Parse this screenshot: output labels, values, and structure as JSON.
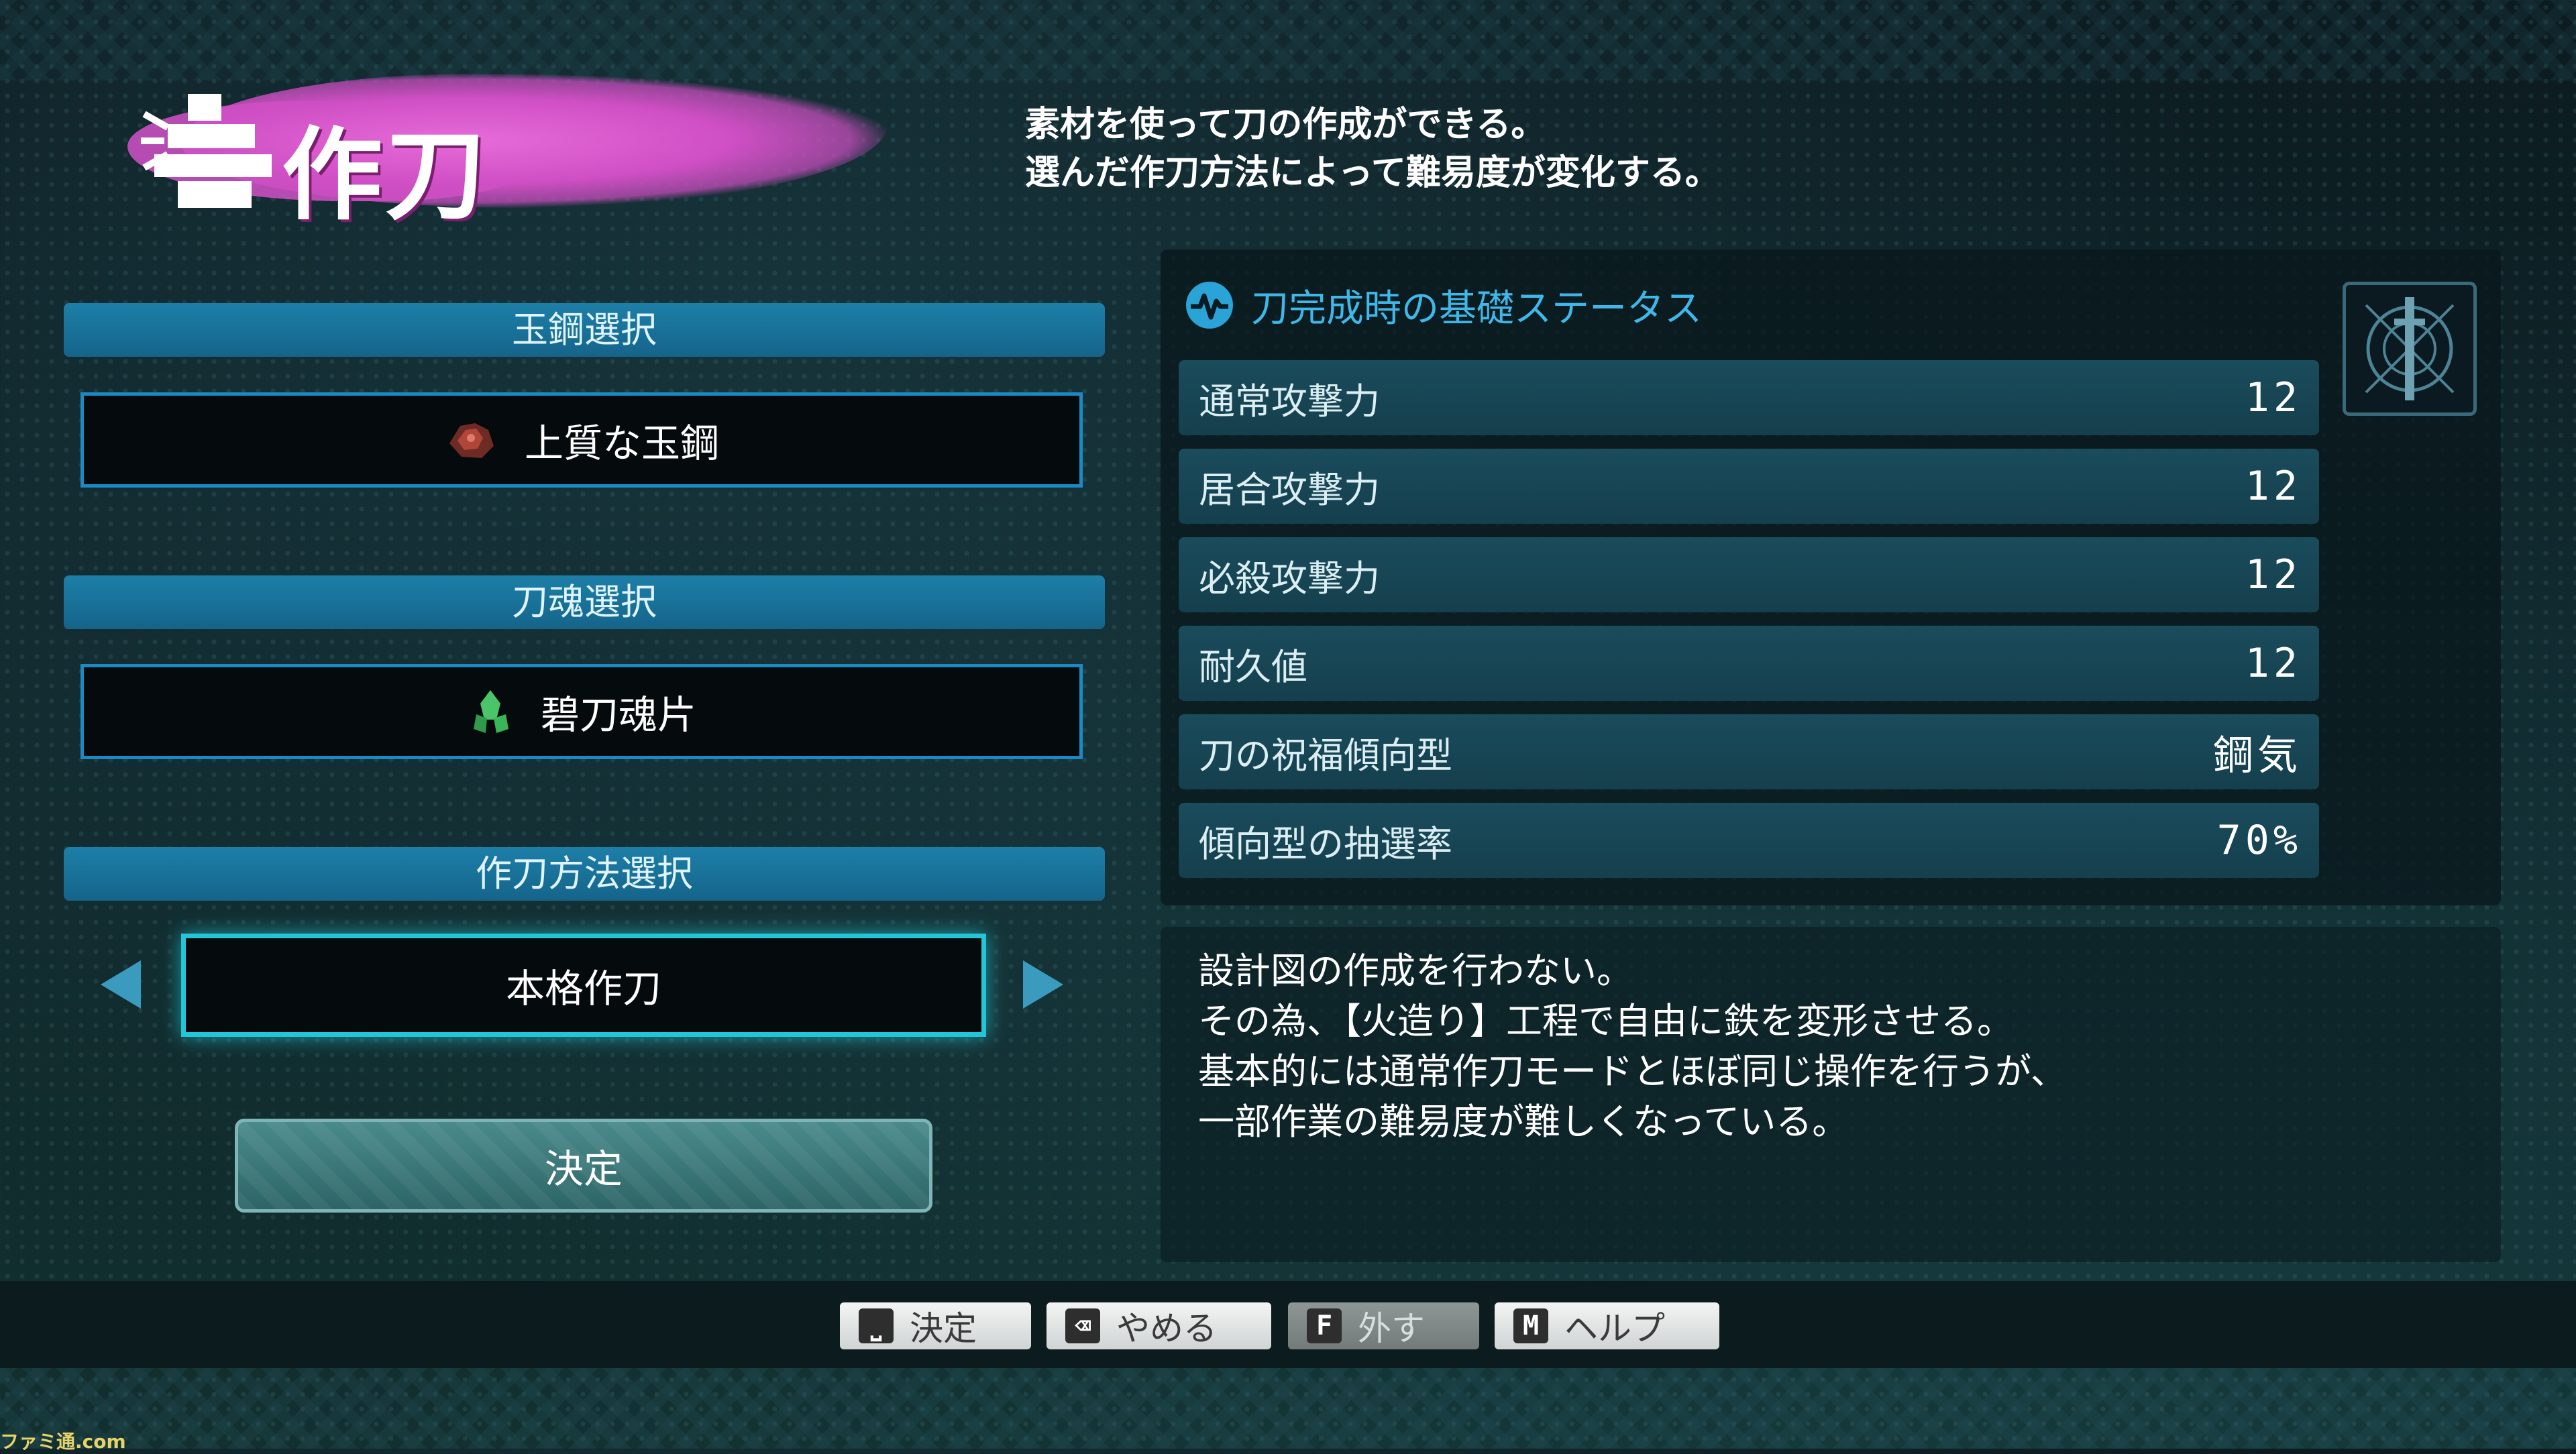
{
  "title": "作刀",
  "intro": {
    "line1": "素材を使って刀の作成ができる。",
    "line2": "選んだ作刀方法によって難易度が変化する。"
  },
  "left": {
    "sections": [
      {
        "header": "玉鋼選択",
        "value": "上質な玉鋼",
        "icon": "steel-ore-icon"
      },
      {
        "header": "刀魂選択",
        "value": "碧刀魂片",
        "icon": "green-crystal-icon"
      },
      {
        "header": "作刀方法選択",
        "value": "本格作刀"
      }
    ],
    "decide_label": "決定"
  },
  "stats": {
    "header": "刀完成時の基礎ステータス",
    "rows": [
      {
        "label": "通常攻撃力",
        "value": "12"
      },
      {
        "label": "居合攻撃力",
        "value": "12"
      },
      {
        "label": "必殺攻撃力",
        "value": "12"
      },
      {
        "label": "耐久値",
        "value": "12"
      },
      {
        "label": "刀の祝福傾向型",
        "value": "鋼気"
      },
      {
        "label": "傾向型の抽選率",
        "value": "70%"
      }
    ]
  },
  "description": {
    "lines": [
      "設計図の作成を行わない。",
      "その為、【火造り】工程で自由に鉄を変形させる。",
      "基本的には通常作刀モードとほぼ同じ操作を行うが、",
      "一部作業の難易度が難しくなっている。"
    ]
  },
  "bottom": {
    "keys": [
      {
        "glyph": "⎵",
        "label": "決定"
      },
      {
        "glyph": "⌫",
        "label": "やめる"
      },
      {
        "glyph": "F",
        "label": "外す"
      },
      {
        "glyph": "M",
        "label": "ヘルプ"
      }
    ]
  },
  "watermark": "ファミ通.com",
  "colors": {
    "accent": "#22c6d6",
    "section_bar": "#1d7fa8",
    "title_brush": "#d452c9",
    "stat_row": "#1a4c5c"
  }
}
